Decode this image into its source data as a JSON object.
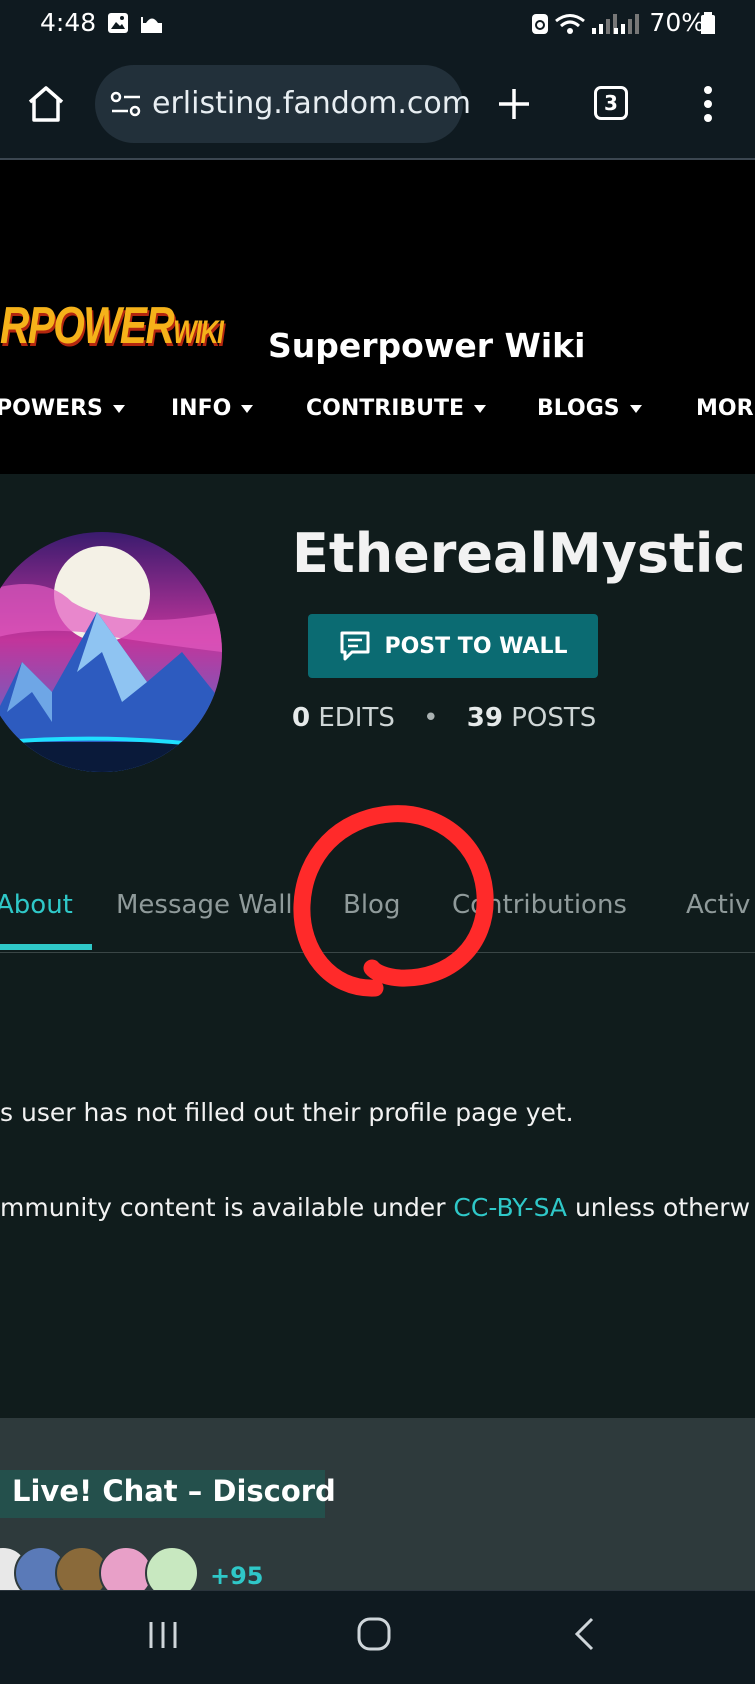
{
  "status_bar": {
    "time": "4:48",
    "battery": "70%"
  },
  "browser": {
    "url": "erlisting.fandom.com",
    "tab_count": "3"
  },
  "wiki": {
    "logo_text": "RPOWER",
    "logo_suffix": "WIKI",
    "title": "Superpower Wiki",
    "nav": [
      "POWERS",
      "INFO",
      "CONTRIBUTE",
      "BLOGS",
      "MORE"
    ]
  },
  "profile": {
    "username": "EtherealMystic",
    "post_wall_label": "POST TO WALL",
    "edits_count": "0",
    "edits_label": "EDITS",
    "posts_count": "39",
    "posts_label": "POSTS"
  },
  "tabs": [
    "About",
    "Message Wall",
    "Blog",
    "Contributions",
    "Activ"
  ],
  "content": {
    "profile_message": "s user has not filled out their profile page yet.",
    "license_prefix": "mmunity content is available under ",
    "license_link": "CC-BY-SA",
    "license_suffix": " unless otherw"
  },
  "discord": {
    "title": "Live! Chat – Discord",
    "more_count": "+95"
  },
  "colors": {
    "accent": "#2fc8c8",
    "button": "#0b6b72",
    "annotation": "#ff2a2a"
  }
}
